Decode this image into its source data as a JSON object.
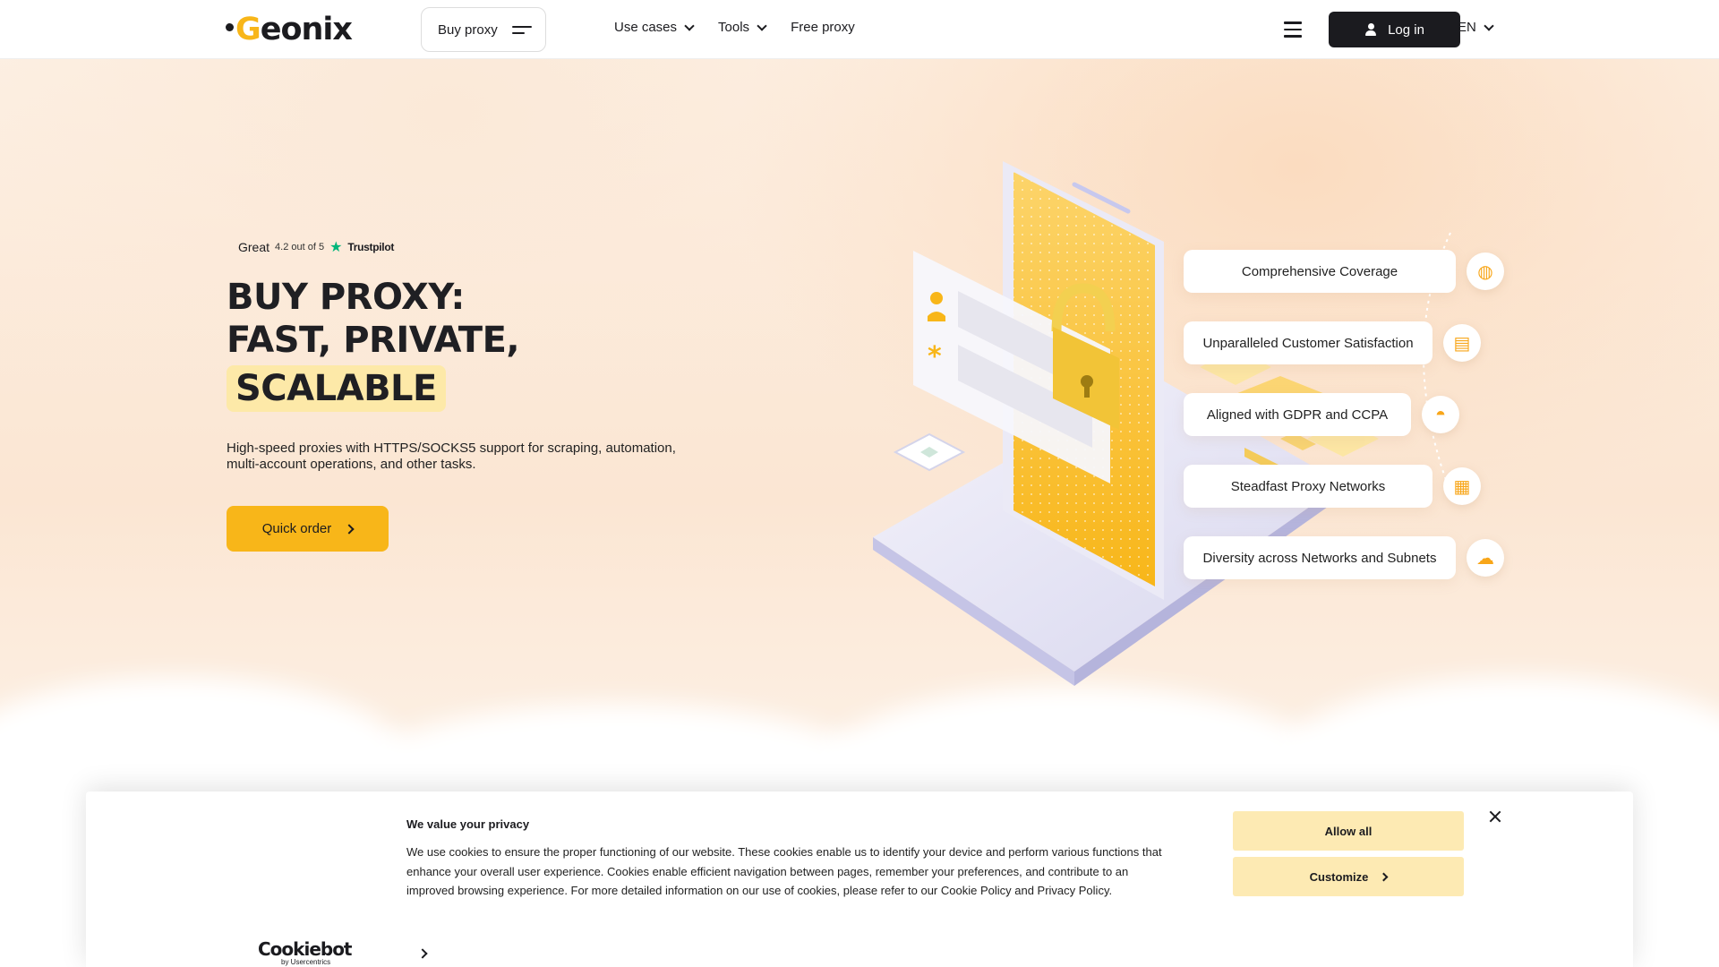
{
  "header": {
    "logo": {
      "prefix": "G",
      "rest": "eonix"
    },
    "buy_proxy_label": "Buy proxy",
    "nav": [
      {
        "label": "Use cases",
        "dropdown": true
      },
      {
        "label": "Tools",
        "dropdown": true
      },
      {
        "label": "Free proxy",
        "dropdown": false
      }
    ],
    "login_label": "Log in",
    "language": "EN"
  },
  "hero": {
    "trustpilot": {
      "verdict": "Great",
      "rating": "4.2 out of 5",
      "brand": "Trustpilot"
    },
    "headline_line1": "BUY PROXY:",
    "headline_line2": "FAST, PRIVATE,",
    "headline_highlight": "SCALABLE",
    "subtext": "High-speed proxies with HTTPS/SOCKS5 support for scraping, automation, multi-account operations, and other tasks.",
    "cta_label": "Quick order"
  },
  "features": [
    {
      "label": "Comprehensive Coverage",
      "icon": "globe-icon"
    },
    {
      "label": "Unparalleled Customer Satisfaction",
      "icon": "chat-icon"
    },
    {
      "label": "Aligned with GDPR and CCPA",
      "icon": "incognito-icon"
    },
    {
      "label": "Steadfast Proxy Networks",
      "icon": "server-icon"
    },
    {
      "label": "Diversity across Networks and Subnets",
      "icon": "cloud-lock-icon"
    }
  ],
  "cookie_banner": {
    "title": "We value your privacy",
    "body": "We use cookies to ensure the proper functioning of our website. These cookies enable us to identify your device and perform various functions that enhance your overall user experience. Cookies enable efficient navigation between pages, remember your preferences, and contribute to an improved browsing experience. For more detailed information on our use of cookies, please refer to our Cookie Policy and Privacy Policy.",
    "allow_all_label": "Allow all",
    "customize_label": "Customize",
    "brand": "Cookiebot",
    "brand_sub": "by Usercentrics"
  },
  "colors": {
    "accent": "#f8b619",
    "highlight": "#fde9a8",
    "dark": "#1b1b1f",
    "cookie_button": "#fdeab3"
  }
}
